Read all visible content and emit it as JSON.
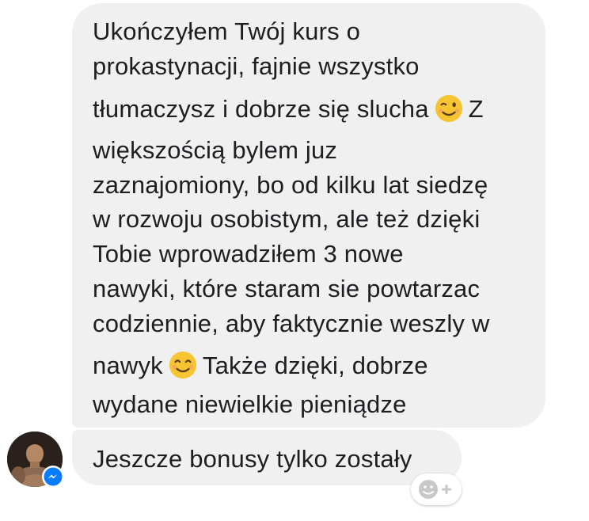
{
  "messages": [
    {
      "lines": [
        {
          "text": "Ukończyłem Twój kurs o"
        },
        {
          "text": "prokastynacji, fajnie wszystko"
        },
        {
          "text": "tłumaczysz i dobrze się slucha",
          "emoji": "winking-face-emoji",
          "after": "Z"
        },
        {
          "text": "większością bylem juz"
        },
        {
          "text": "zaznajomiony, bo od kilku lat siedzę"
        },
        {
          "text": "w rozwoju osobistym, ale też dzięki"
        },
        {
          "text": "Tobie wprowadziłem 3 nowe"
        },
        {
          "text": "nawyki, które staram sie powtarzac"
        },
        {
          "text": "codziennie, aby faktycznie weszly w"
        },
        {
          "text": "nawyk",
          "emoji": "smiling-face-emoji",
          "after": "Także dzięki, dobrze"
        },
        {
          "text": "wydane niewielkie pieniądze"
        }
      ]
    },
    {
      "lines": [
        {
          "text": "Jeszcze bonusy tylko zostały"
        }
      ]
    }
  ],
  "icons": {
    "avatar": "user-avatar-photo",
    "badge": "messenger-badge-icon",
    "reaction": "add-reaction-icon"
  },
  "colors": {
    "bubble_bg": "#f0f0f0",
    "text": "#1c1e21",
    "messenger_blue": "#0a7cff",
    "emoji_yellow": "#f7c531",
    "reaction_gray": "#c8c8c8"
  }
}
